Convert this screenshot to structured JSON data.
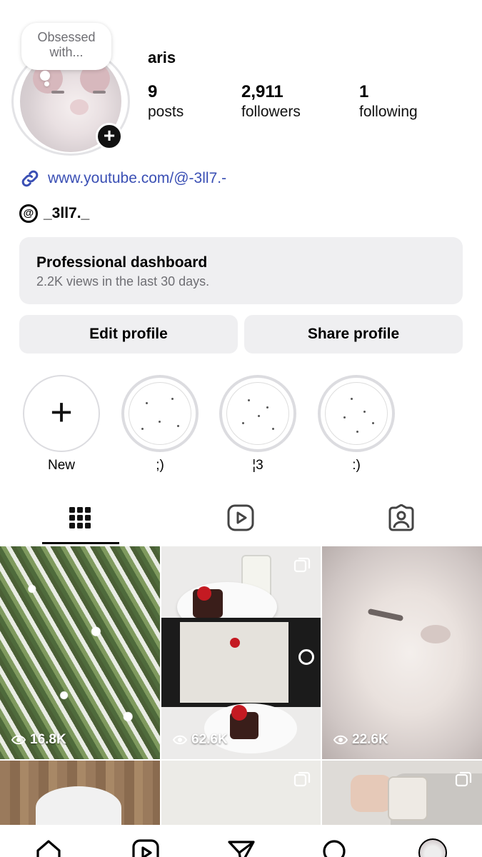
{
  "profile": {
    "note": "Obsessed with...",
    "username": "aris",
    "stats": [
      {
        "value": "9",
        "label": "posts"
      },
      {
        "value": "2,911",
        "label": "followers"
      },
      {
        "value": "1",
        "label": "following"
      }
    ],
    "link": "www.youtube.com/@-3ll7.-",
    "threads_handle": "_3ll7._"
  },
  "dashboard": {
    "title": "Professional dashboard",
    "subtitle": "2.2K views in the last 30 days."
  },
  "buttons": {
    "edit": "Edit profile",
    "share": "Share profile"
  },
  "highlights": [
    {
      "label": "New"
    },
    {
      "label": ";)"
    },
    {
      "label": "¦3"
    },
    {
      "label": ":)"
    }
  ],
  "posts": [
    {
      "views": "16.8K"
    },
    {
      "views": "62.6K"
    },
    {
      "views": "22.6K"
    }
  ],
  "icons": {
    "tabs": [
      "grid-icon",
      "reels-icon",
      "tagged-icon"
    ],
    "nav": [
      "home-icon",
      "reels-icon",
      "direct-icon",
      "search-icon",
      "profile-avatar"
    ]
  }
}
